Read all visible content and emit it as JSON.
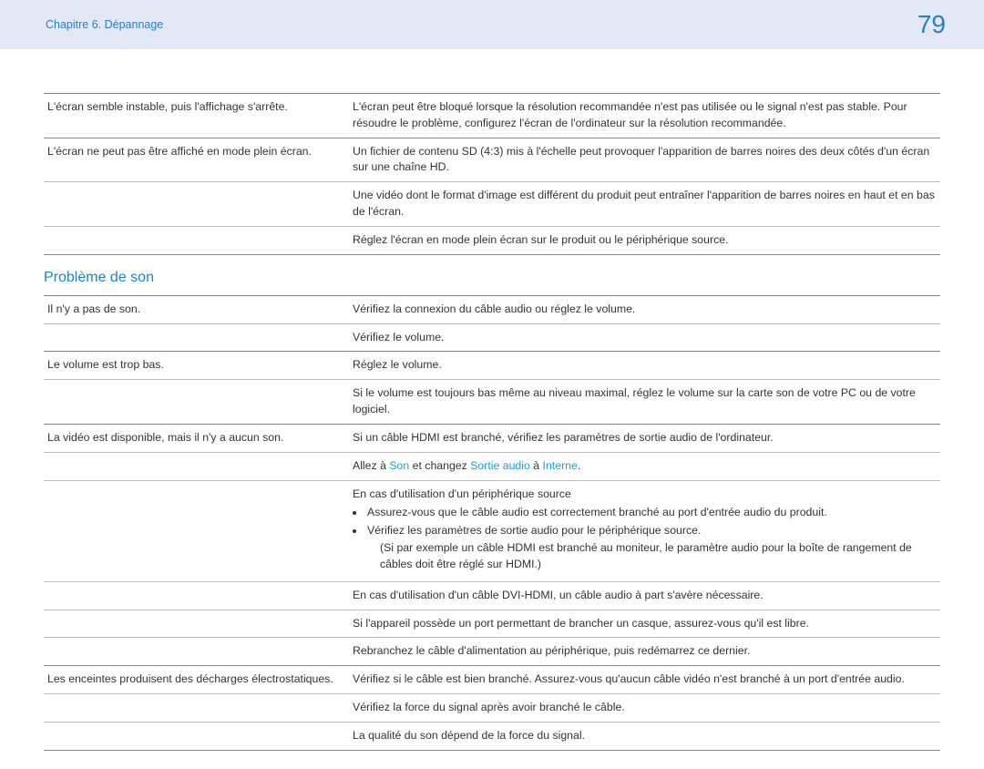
{
  "header": {
    "chapter": "Chapitre 6. Dépannage",
    "page_number": "79"
  },
  "screen_section": {
    "rows": [
      {
        "issue": "L'écran semble instable, puis l'affichage s'arrête.",
        "solutions": [
          "L'écran peut être bloqué lorsque la résolution recommandée n'est pas utilisée ou le signal n'est pas stable. Pour résoudre le problème, configurez l'écran de l'ordinateur sur la résolution recommandée."
        ]
      },
      {
        "issue": "L'écran ne peut pas être affiché en mode plein écran.",
        "solutions": [
          "Un fichier de contenu SD (4:3) mis à l'échelle peut provoquer l'apparition de barres noires des deux côtés d'un écran sur une chaîne HD.",
          "Une vidéo dont le format d'image est différent du produit peut entraîner l'apparition de barres noires en haut et en bas de l'écran.",
          "Réglez l'écran en mode plein écran sur le produit ou le périphérique source."
        ]
      }
    ]
  },
  "sound_section": {
    "title": "Problème de son",
    "rows": [
      {
        "issue": "Il n'y a pas de son.",
        "solutions": [
          "Vérifiez la connexion du câble audio ou réglez le volume.",
          "Vérifiez le volume."
        ]
      },
      {
        "issue": "Le volume est trop bas.",
        "solutions": [
          "Réglez le volume.",
          "Si le volume est toujours bas même au niveau maximal, réglez le volume sur la carte son de votre PC ou de votre logiciel."
        ]
      },
      {
        "issue": "La vidéo est disponible, mais il n'y a aucun son.",
        "sol_plain_0": "Si un câble HDMI est branché, vérifiez les paramètres de sortie audio de l'ordinateur.",
        "sol_mixed": {
          "pre": "Allez à ",
          "hl1": "Son",
          "mid": " et changez ",
          "hl2": "Sortie audio",
          "mid2": " à ",
          "hl3": "Interne",
          "post": "."
        },
        "sol_periph_intro": "En cas d'utilisation d'un périphérique source",
        "bullets": [
          "Assurez-vous que le câble audio est correctement branché au port d'entrée audio du produit.",
          "Vérifiez les paramètres de sortie audio pour le périphérique source."
        ],
        "bullet_sub": "(Si par exemple un câble HDMI est branché au moniteur, le paramètre audio pour la boîte de rangement de câbles doit être réglé sur HDMI.)",
        "sol_plain_3": "En cas d'utilisation d'un câble DVI-HDMI, un câble audio à part s'avère nécessaire.",
        "sol_plain_4": "Si l'appareil possède un port permettant de brancher un casque, assurez-vous qu'il est libre.",
        "sol_plain_5": "Rebranchez le câble d'alimentation au périphérique, puis redémarrez ce dernier."
      },
      {
        "issue": "Les enceintes produisent des décharges électrostatiques.",
        "solutions": [
          "Vérifiez si le câble est bien branché. Assurez-vous qu'aucun câble vidéo n'est branché à un port d'entrée audio.",
          "Vérifiez la force du signal après avoir branché le câble.",
          "La qualité du son dépend de la force du signal."
        ]
      }
    ]
  }
}
